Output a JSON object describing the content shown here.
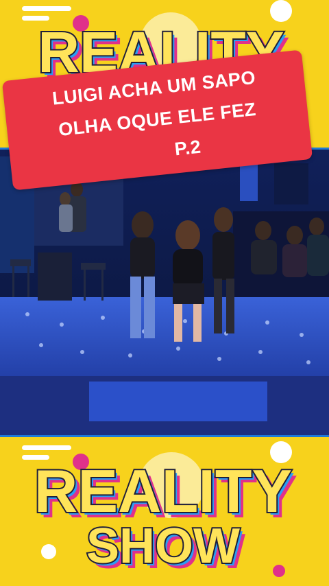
{
  "logo": {
    "title_word": "REALITY",
    "subtitle_word": "SHOW"
  },
  "caption": {
    "lines": [
      "LUIGI ACHA UM SAPO",
      "OLHA OQUE ELE FEZ",
      "P.2"
    ]
  },
  "colors": {
    "background_yellow": "#f7d21c",
    "caption_red": "#ea3544",
    "logo_fill": "#ffe45a",
    "logo_outline": "#1f1f3a",
    "logo_shadow_blue": "#2a9df4",
    "logo_shadow_pink": "#e0318a",
    "stage_blue": "#2b50c9"
  },
  "icons": [
    "white-stripe-decoration",
    "pink-dot-decoration",
    "white-circle-decoration"
  ]
}
